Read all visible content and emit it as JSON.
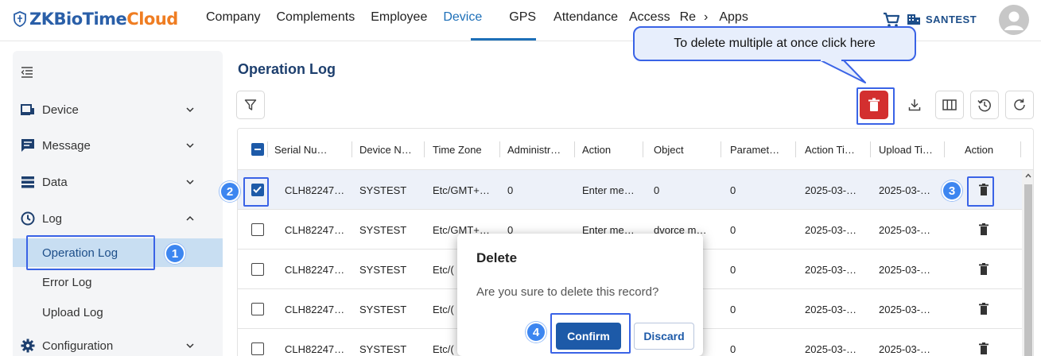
{
  "app": {
    "logo_main": "ZKBioTime",
    "logo_accent": "Cloud",
    "nav": [
      "Company",
      "Complements",
      "Employee",
      "Device",
      "GPS",
      "Attendance",
      "Access",
      "Re",
      "›",
      "Apps"
    ],
    "active_nav": "Device",
    "company_name": "SANTEST"
  },
  "sidebar": {
    "items": [
      {
        "label": "Device"
      },
      {
        "label": "Message"
      },
      {
        "label": "Data"
      },
      {
        "label": "Log"
      },
      {
        "label": "Configuration"
      }
    ],
    "log_sub": [
      {
        "label": "Operation Log"
      },
      {
        "label": "Error Log"
      },
      {
        "label": "Upload Log"
      }
    ]
  },
  "main": {
    "title": "Operation Log",
    "callout": "To delete multiple at once click here"
  },
  "table": {
    "columns": [
      "Serial Nu…",
      "Device N…",
      "Time Zone",
      "Administr…",
      "Action",
      "Object",
      "Paramet…",
      "Action Ti…",
      "Upload Ti…",
      "Action"
    ],
    "rows": [
      {
        "serial": "CLH82247…",
        "device": "SYSTEST",
        "tz": "Etc/GMT+…",
        "admin": "0",
        "action": "Enter me…",
        "object": "0",
        "param": "0",
        "action_time": "2025-03-…",
        "upload_time": "2025-03-…",
        "checked": true
      },
      {
        "serial": "CLH82247…",
        "device": "SYSTEST",
        "tz": "Etc/GMT+…",
        "admin": "0",
        "action": "Enter me…",
        "object": "dvorce m…",
        "param": "0",
        "action_time": "2025-03-…",
        "upload_time": "2025-03-…",
        "checked": false
      },
      {
        "serial": "CLH82247…",
        "device": "SYSTEST",
        "tz": "Etc/(",
        "admin": "",
        "action": "",
        "object": "",
        "param": "0",
        "action_time": "2025-03-…",
        "upload_time": "2025-03-…",
        "checked": false
      },
      {
        "serial": "CLH82247…",
        "device": "SYSTEST",
        "tz": "Etc/(",
        "admin": "",
        "action": "",
        "object": "",
        "param": "0",
        "action_time": "2025-03-…",
        "upload_time": "2025-03-…",
        "checked": false
      },
      {
        "serial": "CLH82247…",
        "device": "SYSTEST",
        "tz": "Etc/(",
        "admin": "",
        "action": "",
        "object": "",
        "param": "0",
        "action_time": "2025-03-…",
        "upload_time": "2025-03-…",
        "checked": false
      }
    ]
  },
  "dialog": {
    "title": "Delete",
    "message": "Are you sure to delete this record?",
    "confirm": "Confirm",
    "discard": "Discard"
  },
  "badges": [
    "1",
    "2",
    "3",
    "4"
  ],
  "colors": {
    "brand_blue": "#2a5fa8",
    "brand_orange": "#ef7d22",
    "primary": "#1d5aa8",
    "delete_red": "#d32f2f",
    "highlight": "#3a63e6",
    "badge": "#3d86f0"
  }
}
